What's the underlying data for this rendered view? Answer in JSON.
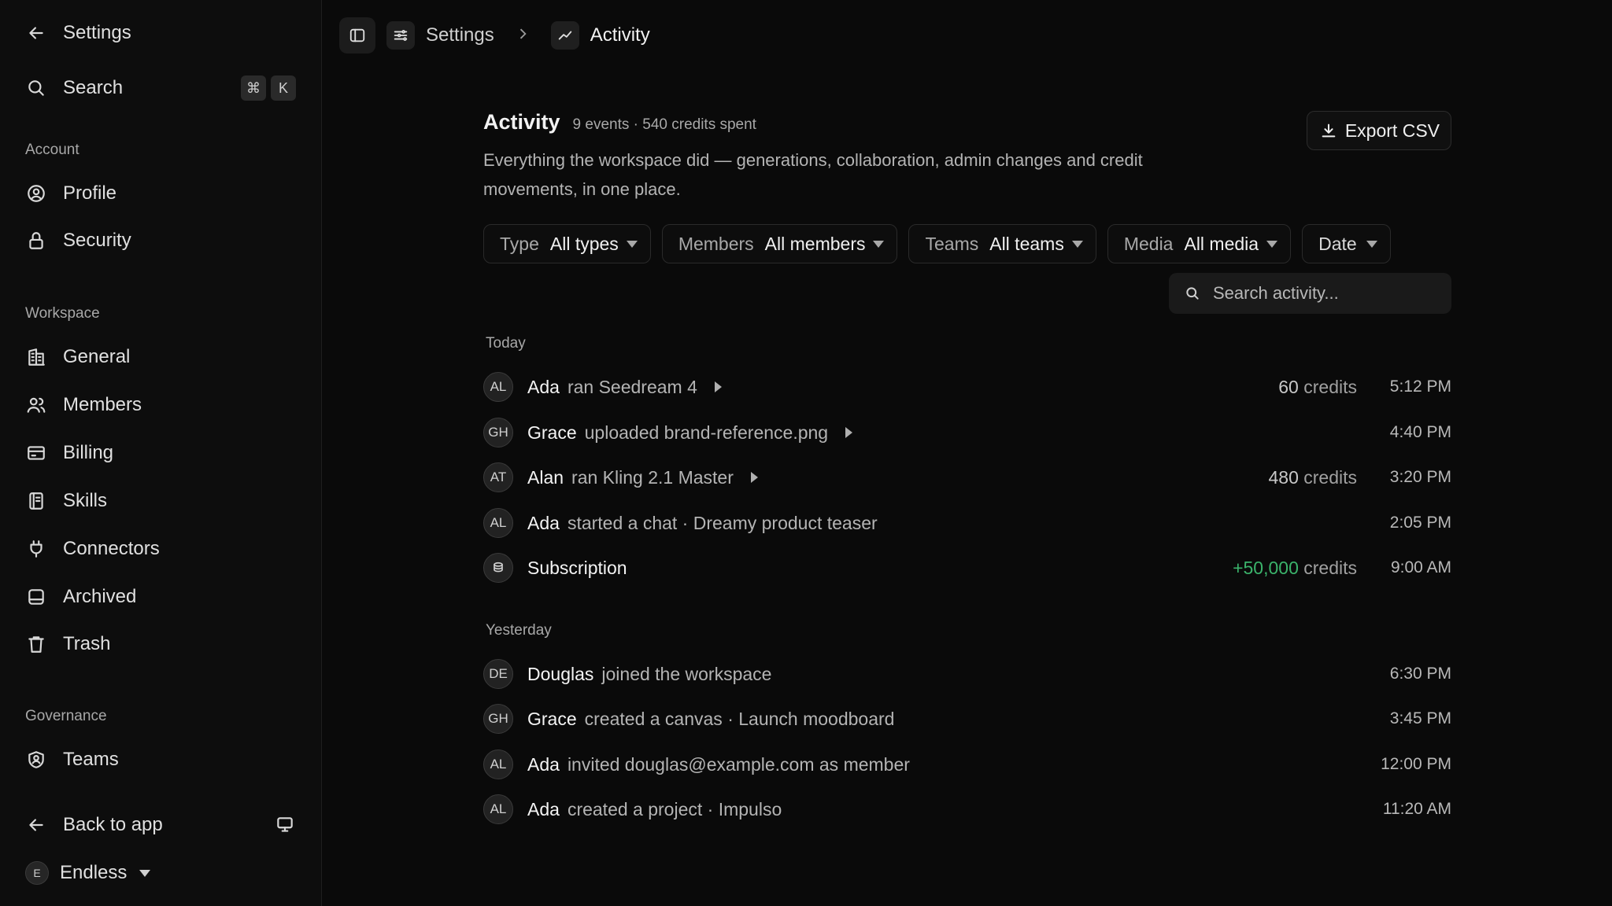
{
  "sidebar": {
    "back_label": "Settings",
    "search_label": "Search",
    "search_keys": [
      "⌘",
      "K"
    ],
    "sections": {
      "account": "Account",
      "workspace": "Workspace",
      "governance": "Governance"
    },
    "items": {
      "profile": "Profile",
      "security": "Security",
      "general": "General",
      "members": "Members",
      "billing": "Billing",
      "skills": "Skills",
      "connectors": "Connectors",
      "archived": "Archived",
      "trash": "Trash",
      "teams": "Teams"
    },
    "back_to_app": "Back to app",
    "workspace_name": "Endless",
    "workspace_initial": "E"
  },
  "breadcrumb": {
    "parent": "Settings",
    "current": "Activity"
  },
  "header": {
    "title": "Activity",
    "meta": "9 events · 540 credits spent",
    "description": "Everything the workspace did — generations, collaboration, admin changes and credit movements, in one place.",
    "export_label": "Export CSV"
  },
  "filters": [
    {
      "label": "Type",
      "value": "All types"
    },
    {
      "label": "Members",
      "value": "All members"
    },
    {
      "label": "Teams",
      "value": "All teams"
    },
    {
      "label": "Media",
      "value": "All media"
    },
    {
      "label": "Date",
      "value": ""
    }
  ],
  "search": {
    "placeholder": "Search activity..."
  },
  "groups": [
    {
      "label": "Today",
      "events": [
        {
          "initials": "AL",
          "actor": "Ada",
          "action": "ran Seedream 4",
          "expandable": true,
          "credits": "60",
          "credits_unit": "credits",
          "time": "5:12 PM"
        },
        {
          "initials": "GH",
          "actor": "Grace",
          "action": "uploaded brand-reference.png",
          "expandable": true,
          "credits": "",
          "credits_unit": "",
          "time": "4:40 PM"
        },
        {
          "initials": "AT",
          "actor": "Alan",
          "action": "ran Kling 2.1 Master",
          "expandable": true,
          "credits": "480",
          "credits_unit": "credits",
          "time": "3:20 PM"
        },
        {
          "initials": "AL",
          "actor": "Ada",
          "action": "started a chat · Dreamy product teaser",
          "expandable": false,
          "credits": "",
          "credits_unit": "",
          "time": "2:05 PM"
        },
        {
          "initials": "",
          "icon": "coins-icon",
          "actor": "Subscription",
          "action": "",
          "expandable": false,
          "credits": "+50,000",
          "credits_unit": "credits",
          "positive": true,
          "time": "9:00 AM"
        }
      ]
    },
    {
      "label": "Yesterday",
      "events": [
        {
          "initials": "DE",
          "actor": "Douglas",
          "action": "joined the workspace",
          "expandable": false,
          "credits": "",
          "credits_unit": "",
          "time": "6:30 PM"
        },
        {
          "initials": "GH",
          "actor": "Grace",
          "action": "created a canvas · Launch moodboard",
          "expandable": false,
          "credits": "",
          "credits_unit": "",
          "time": "3:45 PM"
        },
        {
          "initials": "AL",
          "actor": "Ada",
          "action": "invited douglas@example.com as member",
          "expandable": false,
          "credits": "",
          "credits_unit": "",
          "time": "12:00 PM"
        },
        {
          "initials": "AL",
          "actor": "Ada",
          "action": "created a project · Impulso",
          "expandable": false,
          "credits": "",
          "credits_unit": "",
          "time": "11:20 AM"
        }
      ]
    }
  ],
  "colors": {
    "background": "#0a0a0a",
    "positive": "#3bb36b"
  }
}
